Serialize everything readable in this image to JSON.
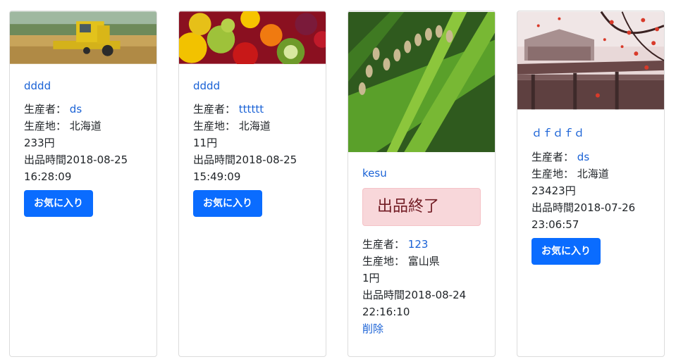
{
  "cards": [
    {
      "title": "dddd",
      "producer_label": "生産者：",
      "producer": "ds",
      "origin_label": "生産地：",
      "origin": "北海道",
      "price": "233円",
      "listed_line1": "出品時間2018-08-25",
      "listed_line2": "16:28:09",
      "button": "お気に入り",
      "image": "harvester-field"
    },
    {
      "title": "dddd",
      "producer_label": "生産者：",
      "producer": "tttttt",
      "origin_label": "生産地：",
      "origin": "北海道",
      "price": "11円",
      "listed_line1": "出品時間2018-08-25",
      "listed_line2": "15:49:09",
      "button": "お気に入り",
      "image": "fruits"
    },
    {
      "title": "kesu",
      "status": "出品終了",
      "producer_label": "生産者：",
      "producer": "123",
      "origin_label": "生産地：",
      "origin": "富山県",
      "price": "1円",
      "listed_line1": "出品時間2018-08-24",
      "listed_line2": "22:16:10",
      "delete": "削除",
      "image": "rice-plant"
    },
    {
      "title": "ｄｆｄｆｄ",
      "producer_label": "生産者：",
      "producer": "ds",
      "origin_label": "生産地：",
      "origin": "北海道",
      "price": "23423円",
      "listed_line1": "出品時間2018-07-26",
      "listed_line2": "23:06:57",
      "button": "お気に入り",
      "image": "bridge-autumn"
    }
  ],
  "colors": {
    "link": "#1a62d6",
    "button": "#0a6cff",
    "soldout_bg": "#f8d7da",
    "soldout_text": "#721c24"
  }
}
